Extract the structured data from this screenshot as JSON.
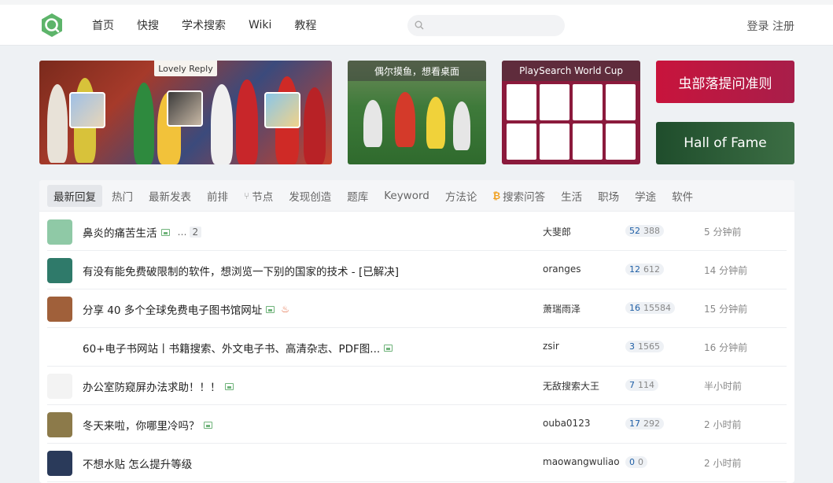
{
  "header": {
    "nav": [
      "首页",
      "快搜",
      "学术搜索",
      "Wiki",
      "教程"
    ],
    "search_placeholder": "",
    "login": "登录",
    "register": "注册"
  },
  "banners": {
    "tooltip": "Lovely Reply",
    "fish_caption": "偶尔摸鱼，想看桌面",
    "worldcup_caption": "PlaySearch World Cup",
    "rules": "虫部落提问准则",
    "hall_of_fame": "Hall of Fame"
  },
  "tabs": [
    "最新回复",
    "热门",
    "最新发表",
    "前排",
    "节点",
    "发现创造",
    "题库",
    "Keyword",
    "方法论",
    "搜索问答",
    "生活",
    "职场",
    "学途",
    "软件"
  ],
  "threads": [
    {
      "title": "鼻炎的痛苦生活",
      "has_image": true,
      "pages": "2",
      "user": "大斐郎",
      "replies": "52",
      "views": "388",
      "time": "5 分钟前",
      "avatar_color": "#8fc9a6"
    },
    {
      "title": "有没有能免费破限制的软件，想浏览一下别的国家的技术 - [已解决]",
      "has_image": false,
      "pages": "",
      "user": "oranges",
      "replies": "12",
      "views": "612",
      "time": "14 分钟前",
      "avatar_color": "#2f7a6a"
    },
    {
      "title": "分享 40 多个全球免费电子图书馆网址",
      "has_image": true,
      "hot": true,
      "pages": "",
      "user": "萧瑞雨泽",
      "replies": "16",
      "views": "15584",
      "time": "15 分钟前",
      "avatar_color": "#a0603a"
    },
    {
      "title": "60+电子书网站丨书籍搜索、外文电子书、高清杂志、PDF图...",
      "has_image": true,
      "pages": "",
      "user": "zsir",
      "replies": "3",
      "views": "1565",
      "time": "16 分钟前",
      "avatar_color": "#ffffff"
    },
    {
      "title": "办公室防窥屏办法求助！！！",
      "has_image": true,
      "pages": "",
      "user": "无敌搜索大王",
      "replies": "7",
      "views": "114",
      "time": "半小时前",
      "avatar_color": "#f3f3f3"
    },
    {
      "title": "冬天来啦，你哪里冷吗？",
      "has_image": true,
      "pages": "",
      "user": "ouba0123",
      "replies": "17",
      "views": "292",
      "time": "2 小时前",
      "avatar_color": "#8c7a4a"
    },
    {
      "title": "不想水贴 怎么提升等级",
      "has_image": false,
      "pages": "",
      "user": "maowangwuliao",
      "replies": "0",
      "views": "0",
      "time": "2 小时前",
      "avatar_color": "#2a3a5a"
    }
  ]
}
